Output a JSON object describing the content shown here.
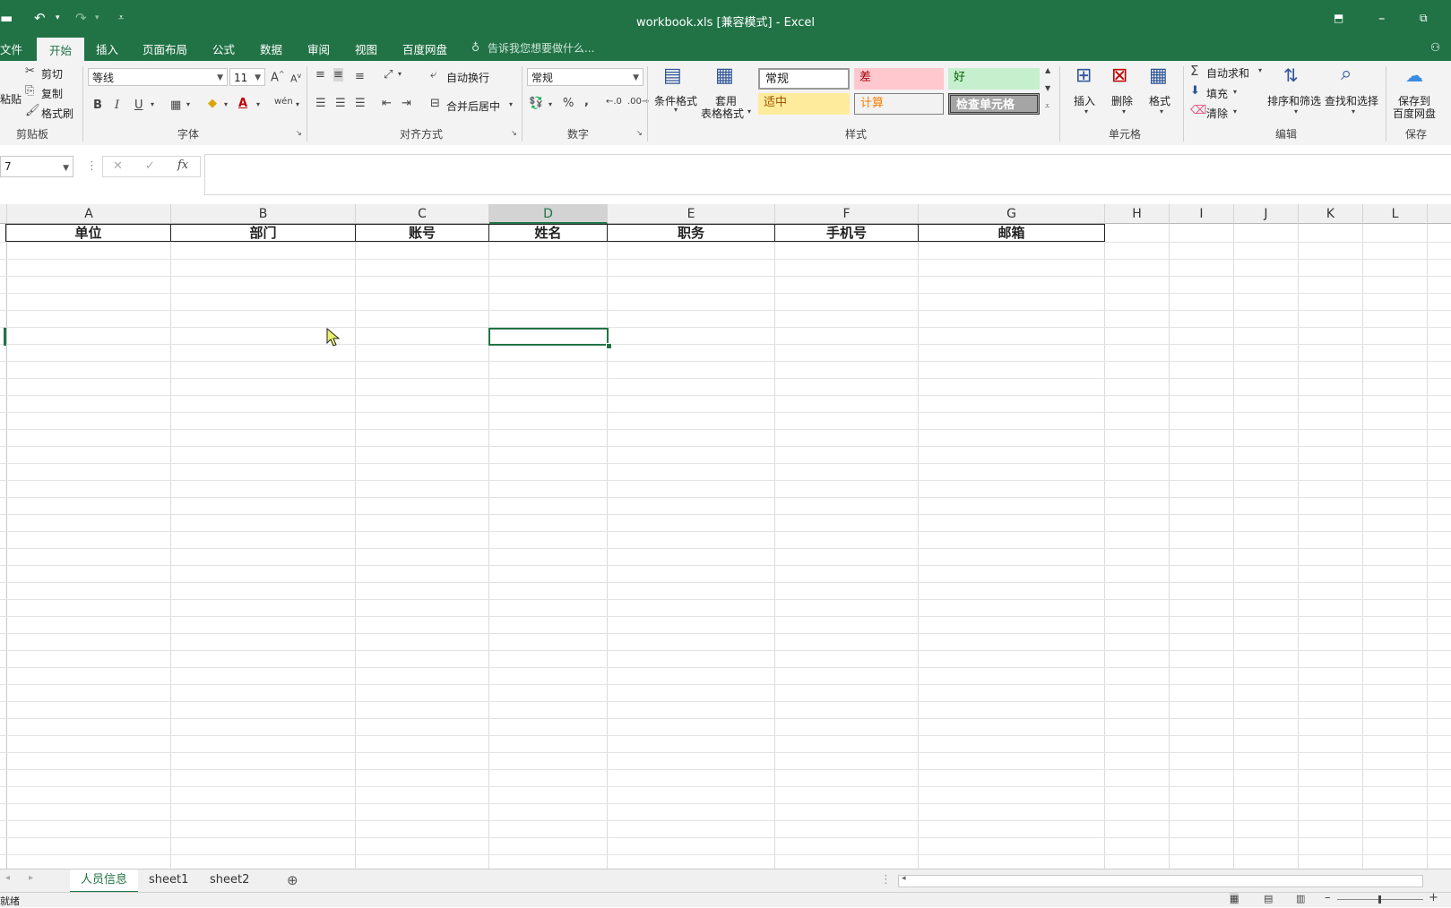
{
  "window": {
    "title": "workbook.xls  [兼容模式] - Excel",
    "accent": "#217346"
  },
  "tabs": [
    "文件",
    "开始",
    "插入",
    "页面布局",
    "公式",
    "数据",
    "审阅",
    "视图",
    "百度网盘"
  ],
  "active_tab": "开始",
  "tell_me": "告诉我您想要做什么...",
  "ribbon": {
    "clipboard": {
      "paste": "粘贴",
      "cut": "剪切",
      "copy": "复制",
      "format_painter": "格式刷",
      "label": "剪贴板"
    },
    "font": {
      "name": "等线",
      "size": "11",
      "bold": "B",
      "italic": "I",
      "underline": "U",
      "label": "字体"
    },
    "alignment": {
      "wrap": "自动换行",
      "merge": "合并后居中",
      "label": "对齐方式"
    },
    "number": {
      "format": "常规",
      "label": "数字"
    },
    "styles": {
      "conditional": "条件格式",
      "table_format_1": "套用",
      "table_format_2": "表格格式",
      "gallery": [
        "常规",
        "差",
        "好",
        "适中",
        "计算",
        "检查单元格"
      ],
      "label": "样式"
    },
    "cells": {
      "insert": "插入",
      "delete": "删除",
      "format": "格式",
      "label": "单元格"
    },
    "editing": {
      "autosum": "自动求和",
      "fill": "填充",
      "clear": "清除",
      "sort": "排序和筛选",
      "find": "查找和选择",
      "label": "编辑"
    },
    "save": {
      "label_1": "保存到",
      "label_2": "百度网盘",
      "label": "保存"
    }
  },
  "formula_bar": {
    "name_box": "7",
    "fx": "fx",
    "content": ""
  },
  "columns": [
    "A",
    "B",
    "C",
    "D",
    "E",
    "F",
    "G",
    "H",
    "I",
    "J",
    "K",
    "L"
  ],
  "selected_column": "D",
  "header_row": [
    "单位",
    "部门",
    "账号",
    "姓名",
    "职务",
    "手机号",
    "邮箱"
  ],
  "sheets": [
    "人员信息",
    "sheet1",
    "sheet2"
  ],
  "active_sheet": "人员信息",
  "status": {
    "left": "就绪"
  }
}
